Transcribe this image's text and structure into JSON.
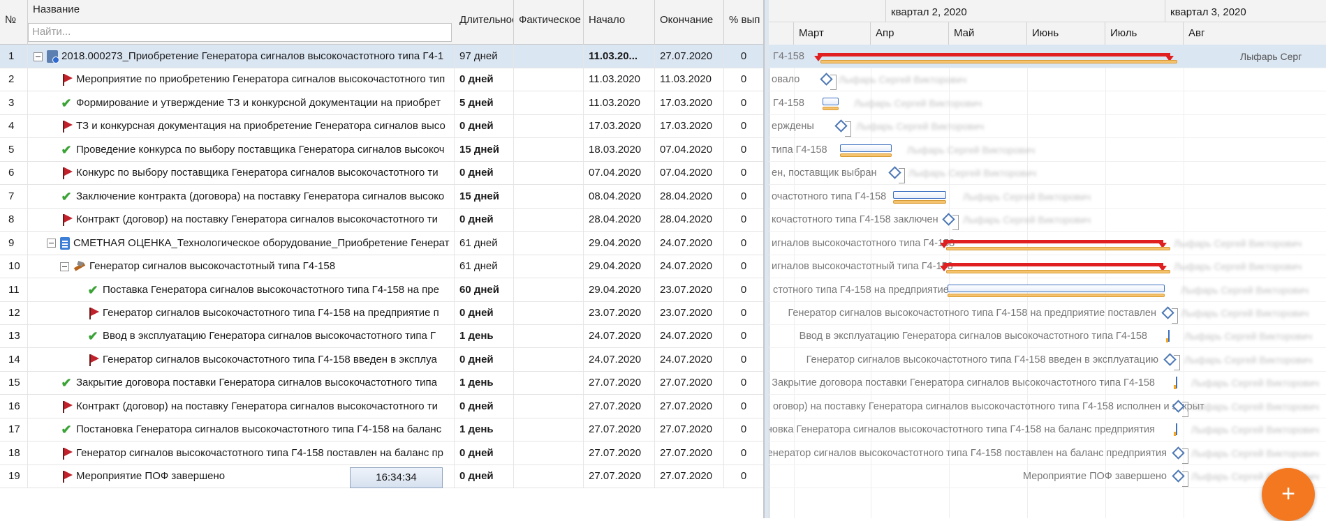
{
  "columns": {
    "num": "№",
    "name": "Название",
    "duration": "Длительнос",
    "actual": "Фактическое",
    "start": "Начало",
    "end": "Окончание",
    "pct": "% вып"
  },
  "search": {
    "placeholder": "Найти..."
  },
  "clock": "16:34:34",
  "fab_label": "+",
  "gantt_header": {
    "quarters": [
      "квартал 2, 2020",
      "квартал 3, 2020"
    ],
    "months": [
      "Март",
      "Апр",
      "Май",
      "Июнь",
      "Июль",
      "Авг"
    ]
  },
  "resource_name": "Лыфарь Сергей Викторович",
  "resource_clear": "Лыфарь Серг",
  "rows": [
    {
      "num": "1",
      "name": "2018.000273_Приобретение Генератора сигналов высокочастотного типа Г4-1",
      "duration": "97 дней",
      "actual": "",
      "start": "11.03.20...",
      "end": "27.07.2020",
      "pct": "0",
      "icon": "project-icon",
      "indent": 0,
      "toggle": true,
      "bold_dur": false,
      "bold_start": true,
      "gantt_label": "Г4-158"
    },
    {
      "num": "2",
      "name": "Мероприятие по приобретению Генератора сигналов высокочастотного тип",
      "duration": "0 дней",
      "actual": "",
      "start": "11.03.2020",
      "end": "11.03.2020",
      "pct": "0",
      "icon": "flag-icon",
      "indent": 1,
      "toggle": false,
      "bold_dur": true,
      "bold_start": false,
      "gantt_label": "овало"
    },
    {
      "num": "3",
      "name": "Формирование и утверждение ТЗ и конкурсной документации на приобрет",
      "duration": "5 дней",
      "actual": "",
      "start": "11.03.2020",
      "end": "17.03.2020",
      "pct": "0",
      "icon": "check-icon",
      "indent": 1,
      "toggle": false,
      "bold_dur": true,
      "bold_start": false,
      "gantt_label": "Г4-158"
    },
    {
      "num": "4",
      "name": "ТЗ и конкурсная документация на приобретение Генератора сигналов высо",
      "duration": "0 дней",
      "actual": "",
      "start": "17.03.2020",
      "end": "17.03.2020",
      "pct": "0",
      "icon": "flag-icon",
      "indent": 1,
      "toggle": false,
      "bold_dur": true,
      "bold_start": false,
      "gantt_label": "ерждены"
    },
    {
      "num": "5",
      "name": "Проведение конкурса по выбору поставщика Генератора сигналов высокоч",
      "duration": "15 дней",
      "actual": "",
      "start": "18.03.2020",
      "end": "07.04.2020",
      "pct": "0",
      "icon": "check-icon",
      "indent": 1,
      "toggle": false,
      "bold_dur": true,
      "bold_start": false,
      "gantt_label": "типа Г4-158"
    },
    {
      "num": "6",
      "name": "Конкурс по выбору поставщика Генератора сигналов высокочастотного ти",
      "duration": "0 дней",
      "actual": "",
      "start": "07.04.2020",
      "end": "07.04.2020",
      "pct": "0",
      "icon": "flag-icon",
      "indent": 1,
      "toggle": false,
      "bold_dur": true,
      "bold_start": false,
      "gantt_label": "ен, поставщик выбран"
    },
    {
      "num": "7",
      "name": "Заключение контракта (договора) на поставку Генератора сигналов высоко",
      "duration": "15 дней",
      "actual": "",
      "start": "08.04.2020",
      "end": "28.04.2020",
      "pct": "0",
      "icon": "check-icon",
      "indent": 1,
      "toggle": false,
      "bold_dur": true,
      "bold_start": false,
      "gantt_label": "очастотного типа Г4-158"
    },
    {
      "num": "8",
      "name": "Контракт (договор) на поставку Генератора сигналов высокочастотного ти",
      "duration": "0 дней",
      "actual": "",
      "start": "28.04.2020",
      "end": "28.04.2020",
      "pct": "0",
      "icon": "flag-icon",
      "indent": 1,
      "toggle": false,
      "bold_dur": true,
      "bold_start": false,
      "gantt_label": "кочастотного типа Г4-158 заключен"
    },
    {
      "num": "9",
      "name": "СМЕТНАЯ ОЦЕНКА_Технологическое оборудование_Приобретение Генерат",
      "duration": "61 дней",
      "actual": "",
      "start": "29.04.2020",
      "end": "24.07.2020",
      "pct": "0",
      "icon": "document-icon",
      "indent": 1,
      "toggle": true,
      "bold_dur": false,
      "bold_start": false,
      "gantt_label": "игналов высокочастотного типа Г4-158"
    },
    {
      "num": "10",
      "name": "Генератор сигналов высокочастотный типа Г4-158",
      "duration": "61 дней",
      "actual": "",
      "start": "29.04.2020",
      "end": "24.07.2020",
      "pct": "0",
      "icon": "tools-icon",
      "indent": 2,
      "toggle": true,
      "bold_dur": false,
      "bold_start": false,
      "gantt_label": "игналов высокочастотный типа Г4-158"
    },
    {
      "num": "11",
      "name": "Поставка Генератора сигналов высокочастотного типа Г4-158 на пре",
      "duration": "60 дней",
      "actual": "",
      "start": "29.04.2020",
      "end": "23.07.2020",
      "pct": "0",
      "icon": "check-icon",
      "indent": 3,
      "toggle": false,
      "bold_dur": true,
      "bold_start": false,
      "gantt_label": "стотного типа Г4-158 на предприятие"
    },
    {
      "num": "12",
      "name": "Генератор сигналов высокочастотного типа Г4-158 на предприятие п",
      "duration": "0 дней",
      "actual": "",
      "start": "23.07.2020",
      "end": "23.07.2020",
      "pct": "0",
      "icon": "flag-icon",
      "indent": 3,
      "toggle": false,
      "bold_dur": true,
      "bold_start": false,
      "gantt_label": "Генератор сигналов высокочастотного типа Г4-158 на предприятие поставлен"
    },
    {
      "num": "13",
      "name": "Ввод в эксплуатацию Генератора сигналов высокочастотного типа Г",
      "duration": "1 день",
      "actual": "",
      "start": "24.07.2020",
      "end": "24.07.2020",
      "pct": "0",
      "icon": "check-icon",
      "indent": 3,
      "toggle": false,
      "bold_dur": true,
      "bold_start": false,
      "gantt_label": "Ввод в эксплуатацию Генератора сигналов высокочастотного типа Г4-158"
    },
    {
      "num": "14",
      "name": "Генератор сигналов высокочастотного типа Г4-158 введен в эксплуа",
      "duration": "0 дней",
      "actual": "",
      "start": "24.07.2020",
      "end": "24.07.2020",
      "pct": "0",
      "icon": "flag-icon",
      "indent": 3,
      "toggle": false,
      "bold_dur": true,
      "bold_start": false,
      "gantt_label": "Генератор сигналов высокочастотного типа Г4-158 введен в эксплуатацию"
    },
    {
      "num": "15",
      "name": "Закрытие договора поставки Генератора сигналов высокочастотного типа",
      "duration": "1 день",
      "actual": "",
      "start": "27.07.2020",
      "end": "27.07.2020",
      "pct": "0",
      "icon": "check-icon",
      "indent": 1,
      "toggle": false,
      "bold_dur": true,
      "bold_start": false,
      "gantt_label": "Закрытие договора поставки Генератора сигналов высокочастотного типа Г4-158"
    },
    {
      "num": "16",
      "name": "Контракт (договор) на поставку Генератора сигналов высокочастотного ти",
      "duration": "0 дней",
      "actual": "",
      "start": "27.07.2020",
      "end": "27.07.2020",
      "pct": "0",
      "icon": "flag-icon",
      "indent": 1,
      "toggle": false,
      "bold_dur": true,
      "bold_start": false,
      "gantt_label": "оговор) на поставку Генератора сигналов высокочастотного типа Г4-158 исполнен и закрыт"
    },
    {
      "num": "17",
      "name": "Постановка Генератора сигналов высокочастотного типа Г4-158 на баланс",
      "duration": "1 день",
      "actual": "",
      "start": "27.07.2020",
      "end": "27.07.2020",
      "pct": "0",
      "icon": "check-icon",
      "indent": 1,
      "toggle": false,
      "bold_dur": true,
      "bold_start": false,
      "gantt_label": "Постановка Генератора сигналов высокочастотного типа Г4-158 на баланс предприятия"
    },
    {
      "num": "18",
      "name": "Генератор сигналов высокочастотного типа Г4-158 поставлен на баланс пр",
      "duration": "0 дней",
      "actual": "",
      "start": "27.07.2020",
      "end": "27.07.2020",
      "pct": "0",
      "icon": "flag-icon",
      "indent": 1,
      "toggle": false,
      "bold_dur": true,
      "bold_start": false,
      "gantt_label": "Генератор сигналов высокочастотного типа Г4-158 поставлен на баланс предприятия"
    },
    {
      "num": "19",
      "name": "Мероприятие ПОФ завершено",
      "duration": "0 дней",
      "actual": "",
      "start": "27.07.2020",
      "end": "27.07.2020",
      "pct": "0",
      "icon": "flag-icon",
      "indent": 1,
      "toggle": false,
      "bold_dur": true,
      "bold_start": false,
      "gantt_label": "Мероприятие ПОФ завершено"
    }
  ]
}
